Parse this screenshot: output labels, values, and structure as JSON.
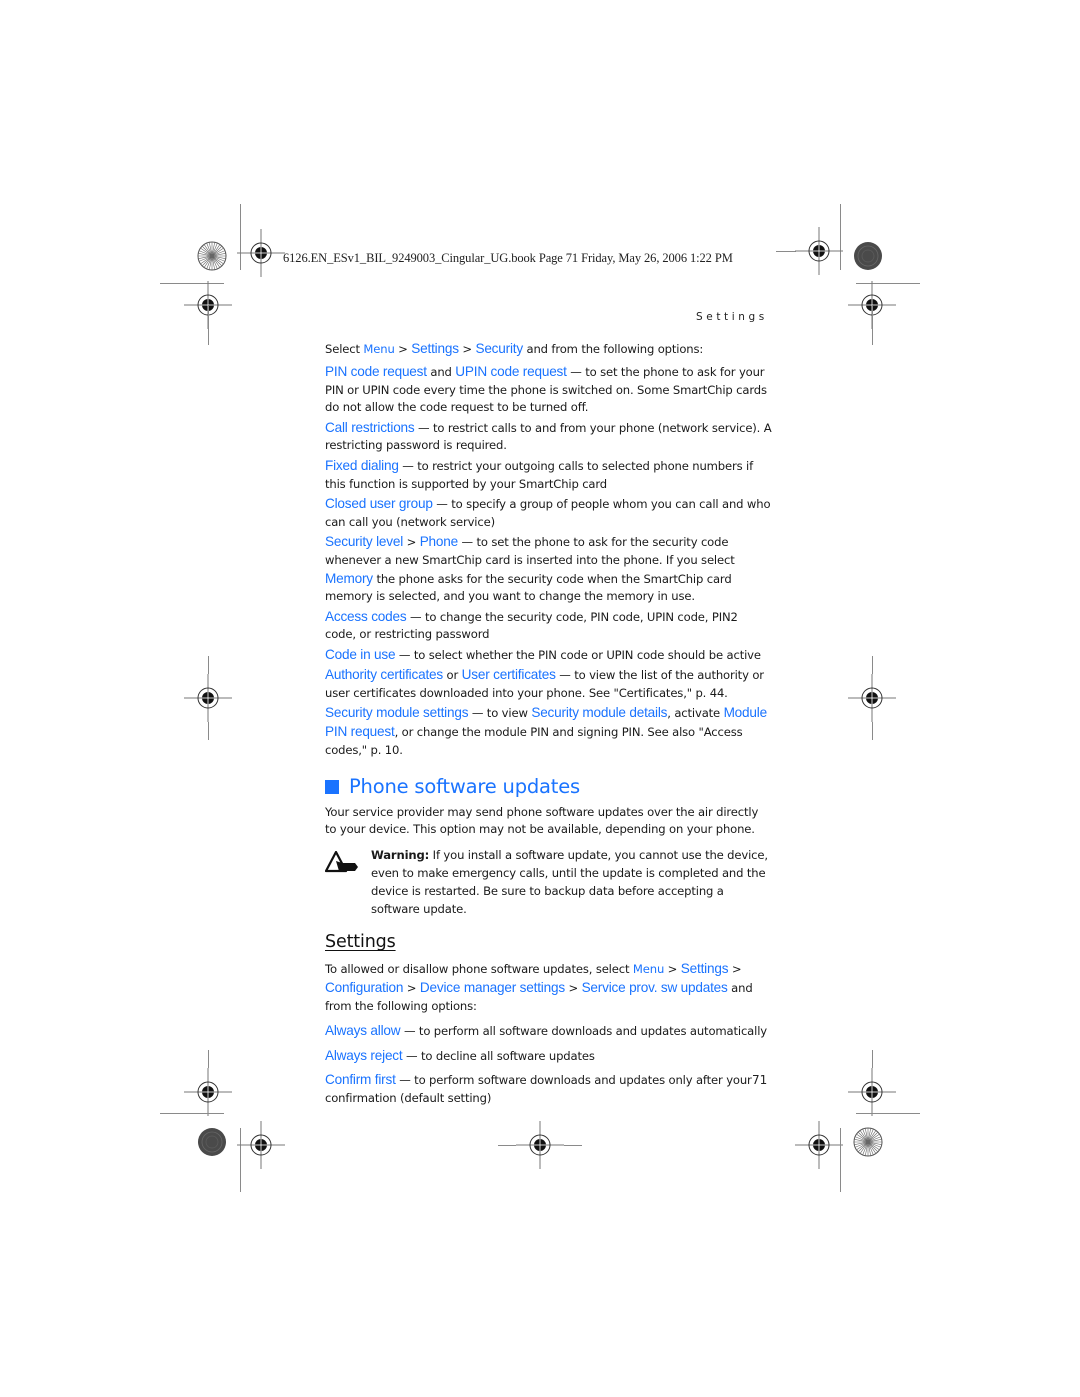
{
  "slug": "6126.EN_ESv1_BIL_9249003_Cingular_UG.book  Page 71  Friday, May 26, 2006  1:22 PM",
  "running_head": "Settings",
  "page_number": "71",
  "colors": {
    "accent": "#1a73ff",
    "text": "#1a1a1a",
    "crop_marks": "#8a8a8a"
  },
  "security": {
    "intro": {
      "pre": "Select ",
      "menu": "Menu",
      "sep1": " > ",
      "settings": "Settings",
      "sep2": " > ",
      "security": "Security",
      "post": " and from the following options:"
    },
    "options": [
      {
        "term": "PIN code request",
        "mid": " and ",
        "term2": "UPIN code request",
        "desc": " — to set the phone to ask for your PIN or UPIN code every time the phone is switched on. Some SmartChip cards do not allow the code request to be turned off."
      },
      {
        "term": "Call restrictions",
        "desc": " — to restrict calls to and from your phone (network service). A restricting password is required."
      },
      {
        "term": "Fixed dialing",
        "desc": " — to restrict your outgoing calls to selected phone numbers if this function is supported by your SmartChip card"
      },
      {
        "term": "Closed user group",
        "desc": " — to specify a group of people whom you can call and who can call you (network service)"
      },
      {
        "term": "Security level",
        "mid": " > ",
        "term2": "Phone",
        "desc": " — to set the phone to ask for the security code whenever a new SmartChip card is inserted into the phone. If you select ",
        "term3": "Memory",
        "desc2": " the phone asks for the security code when the SmartChip card memory is selected, and you want to change the memory in use."
      },
      {
        "term": "Access codes",
        "desc": " — to change the security code, PIN code, UPIN code, PIN2 code, or restricting password"
      },
      {
        "term": "Code in use",
        "desc": " — to select whether the PIN code or UPIN code should be active"
      },
      {
        "term": "Authority certificates",
        "mid": " or ",
        "term2": "User certificates",
        "desc": " — to view the list of the authority or user certificates downloaded into your phone. See \"Certificates,\" p. 44."
      },
      {
        "term": "Security module settings",
        "desc": " — to view ",
        "term2": "Security module details",
        "mid": ", activate ",
        "term3": "Module PIN request",
        "desc2": ", or change the module PIN and signing PIN. See also \"Access codes,\" p. 10."
      }
    ]
  },
  "updates": {
    "heading": "Phone software updates",
    "body": "Your service provider may send phone software updates over the air directly to your device. This option may not be available, depending on your phone.",
    "warning_label": "Warning:",
    "warning_text": " If you install a software update, you cannot use the device, even to make emergency calls, until the update is completed and the device is restarted. Be sure to backup data before accepting a software update.",
    "warning_icon": "warning-hand-icon"
  },
  "settings": {
    "heading": "Settings",
    "intro": {
      "pre": "To allowed or disallow phone software updates, select ",
      "menu": "Menu",
      "sep1": " > ",
      "settings": "Settings",
      "sep2": " > ",
      "configuration": "Configuration",
      "sep3": " > ",
      "device_manager": "Device manager settings",
      "sep4": " > ",
      "service_prov": "Service prov. sw updates",
      "post": " and from the following options:"
    },
    "options": [
      {
        "term": "Always allow",
        "desc": " — to perform all software downloads and updates automatically"
      },
      {
        "term": "Always reject",
        "desc": " — to decline all software updates"
      },
      {
        "term": "Confirm first",
        "desc": " — to perform software downloads and updates only after your confirmation (default setting)"
      }
    ]
  }
}
